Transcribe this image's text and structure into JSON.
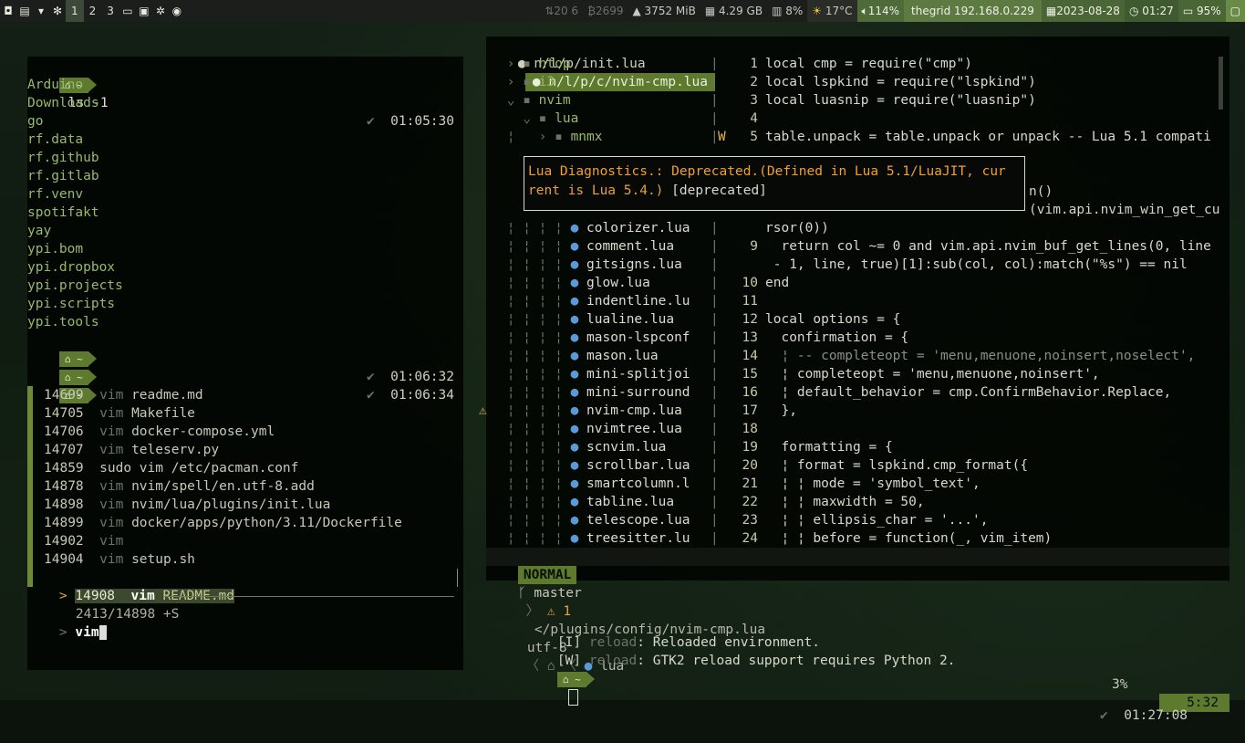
{
  "topbar": {
    "workspaces": [
      "1",
      "2",
      "3"
    ],
    "active_workspace": "1",
    "stats": {
      "net": "20 6",
      "disk": "2699",
      "mem": "3752 MiB",
      "storage": "4.29 GB",
      "cpu": "8%",
      "temp": "17°C",
      "volume": "114%",
      "network": "thegrid 192.168.0.229",
      "date": "2023-08-28",
      "time": "01:27",
      "battery": "95%"
    }
  },
  "term1": {
    "prompt_home": "~",
    "cmd": "ls -1",
    "check": "✔",
    "time1": "01:05:30",
    "files": [
      "Arduino",
      "Downloads",
      "go",
      "rf.data",
      "rf.github",
      "rf.gitlab",
      "rf.venv",
      "spotifakt",
      "yay",
      "ypi.bom",
      "ypi.dropbox",
      "ypi.projects",
      "ypi.scripts",
      "ypi.tools"
    ],
    "time2": "01:06:32",
    "time3": "01:06:34",
    "history": [
      {
        "n": "14699",
        "cmd": "vim",
        "arg": "readme.md"
      },
      {
        "n": "14705",
        "cmd": "vim",
        "arg": "Makefile"
      },
      {
        "n": "14706",
        "cmd": "vim",
        "arg": "docker-compose.yml"
      },
      {
        "n": "14707",
        "cmd": "vim",
        "arg": "teleserv.py"
      },
      {
        "n": "14859",
        "cmd": "sudo vim",
        "arg": "/etc/pacman.conf"
      },
      {
        "n": "14878",
        "cmd": "vim",
        "arg": "nvim/spell/en.utf-8.add"
      },
      {
        "n": "14898",
        "cmd": "vim",
        "arg": "nvim/lua/plugins/init.lua"
      },
      {
        "n": "14899",
        "cmd": "vim",
        "arg": "docker/apps/python/3.11/Dockerfile"
      },
      {
        "n": "14902",
        "cmd": "vim",
        "arg": ""
      },
      {
        "n": "14904",
        "cmd": "vim",
        "arg": "setup.sh"
      }
    ],
    "selected": {
      "n": "14908",
      "cmd": "vim",
      "arg": "README.md"
    },
    "counter": "2413/14898 +S",
    "query": "vim"
  },
  "nvim": {
    "tab1": "n/l/p/init.lua",
    "tab2": "n/l/p/c/nvim-cmp.lua",
    "tree": [
      "htop",
      "i3",
      "nvim",
      "lua",
      "mnmx"
    ],
    "tree_files": [
      "colorizer.lua",
      "comment.lua",
      "gitsigns.lua",
      "glow.lua",
      "indentline.lu",
      "lualine.lua",
      "mason-lspconf",
      "mason.lua",
      "mini-splitjoi",
      "mini-surround",
      "nvim-cmp.lua",
      "nvimtree.lua",
      "scnvim.lua",
      "scrollbar.lua",
      "smartcolumn.l",
      "tabline.lua",
      "telescope.lua",
      "treesitter.lu"
    ],
    "code": [
      {
        "n": "1",
        "t": "local cmp = require(\"cmp\")"
      },
      {
        "n": "2",
        "t": "local lspkind = require(\"lspkind\")"
      },
      {
        "n": "3",
        "t": "local luasnip = require(\"luasnip\")"
      },
      {
        "n": "4",
        "t": ""
      },
      {
        "n": "5",
        "t": "table.unpack = table.unpack or unpack -- Lua 5.1 compati"
      }
    ],
    "code_hidden_tail1": "n()",
    "code_hidden_tail2": "(vim.api.nvim_win_get_cu",
    "code2": [
      {
        "n": "",
        "t": "rsor(0))"
      },
      {
        "n": "9",
        "t": "  return col ~= 0 and vim.api.nvim_buf_get_lines(0, line"
      },
      {
        "n": "",
        "t": " - 1, line, true)[1]:sub(col, col):match(\"%s\") == nil"
      },
      {
        "n": "10",
        "t": "end"
      },
      {
        "n": "11",
        "t": ""
      },
      {
        "n": "12",
        "t": "local options = {"
      },
      {
        "n": "13",
        "t": "  confirmation = {"
      },
      {
        "n": "14",
        "t": "  ¦ -- completeopt = 'menu,menuone,noinsert,noselect',"
      },
      {
        "n": "15",
        "t": "  ¦ completeopt = 'menu,menuone,noinsert',"
      },
      {
        "n": "16",
        "t": "  ¦ default_behavior = cmp.ConfirmBehavior.Replace,"
      },
      {
        "n": "17",
        "t": "  },"
      },
      {
        "n": "18",
        "t": ""
      },
      {
        "n": "19",
        "t": "  formatting = {"
      },
      {
        "n": "20",
        "t": "  ¦ format = lspkind.cmp_format({"
      },
      {
        "n": "21",
        "t": "  ¦ ¦ mode = 'symbol_text',"
      },
      {
        "n": "22",
        "t": "  ¦ ¦ maxwidth = 50,"
      },
      {
        "n": "23",
        "t": "  ¦ ¦ ellipsis_char = '...',"
      },
      {
        "n": "24",
        "t": "  ¦ ¦ before = function(_, vim_item)"
      }
    ],
    "diag_line1": "Lua Diagnostics.: Deprecated.(Defined in Lua 5.1/LuaJIT, cur",
    "diag_line2": "rent is Lua 5.4.)",
    "diag_tag": "[deprecated]",
    "status": {
      "mode": "NORMAL",
      "branch": "master",
      "warn": "1",
      "path": "</plugins/config/nvim-cmp.lua",
      "enc": "utf-8",
      "ft": "lua",
      "pct": "3%",
      "pos": "5:32"
    }
  },
  "term2": {
    "line1_tag": "[I]",
    "line1_key": "reload",
    "line1_msg": ": Reloaded environment.",
    "line2_tag": "[W]",
    "line2_key": "reload",
    "line2_msg": ": GTK2 reload support requires Python 2.",
    "check": "✔",
    "time": "01:27:08",
    "home": "~"
  },
  "colors": {
    "accent": "#5d7a2e",
    "bar": "#1c1e1b"
  }
}
